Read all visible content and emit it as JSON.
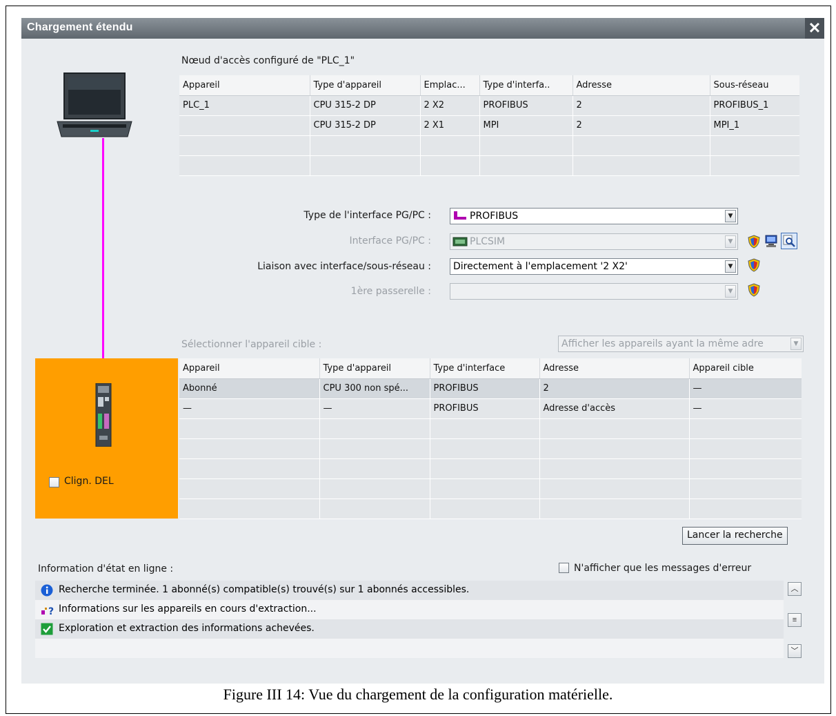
{
  "dialog": {
    "title": "Chargement étendu",
    "close_label": "✕"
  },
  "node": {
    "heading": "Nœud d'accès configuré de \"PLC_1\"",
    "columns": [
      "Appareil",
      "Type d'appareil",
      "Emplac...",
      "Type d'interfa..",
      "Adresse",
      "Sous-réseau"
    ],
    "rows": [
      [
        "PLC_1",
        "CPU 315-2 DP",
        "2 X2",
        "PROFIBUS",
        "2",
        "PROFIBUS_1"
      ],
      [
        "",
        "CPU 315-2 DP",
        "2 X1",
        "MPI",
        "2",
        "MPI_1"
      ],
      [
        "",
        "",
        "",
        "",
        "",
        ""
      ],
      [
        "",
        "",
        "",
        "",
        "",
        ""
      ]
    ]
  },
  "settings": {
    "type_label": "Type de l'interface PG/PC :",
    "type_value": "PROFIBUS",
    "interface_label": "Interface PG/PC :",
    "interface_value": "PLCSIM",
    "liaison_label": "Liaison avec interface/sous-réseau :",
    "liaison_value": "Directement à l'emplacement '2 X2'",
    "gateway_label": "1ère passerelle :",
    "gateway_value": ""
  },
  "target": {
    "select_label": "Sélectionner l'appareil cible :",
    "filter_value": "Afficher les appareils ayant la même adre",
    "columns": [
      "Appareil",
      "Type d'appareil",
      "Type d'interface",
      "Adresse",
      "Appareil cible"
    ],
    "rows": [
      [
        "Abonné",
        "CPU 300 non spé...",
        "PROFIBUS",
        "2",
        "—"
      ],
      [
        "—",
        "—",
        "PROFIBUS",
        "Adresse d'accès",
        "—"
      ],
      [
        "",
        "",
        "",
        "",
        ""
      ],
      [
        "",
        "",
        "",
        "",
        ""
      ],
      [
        "",
        "",
        "",
        "",
        ""
      ],
      [
        "",
        "",
        "",
        "",
        ""
      ],
      [
        "",
        "",
        "",
        "",
        ""
      ]
    ]
  },
  "flash_led_label": "Clign. DEL",
  "search_button": "Lancer la recherche",
  "status": {
    "heading": "Information d'état en ligne :",
    "errors_only_label": "N'afficher que les messages d'erreur",
    "messages": [
      {
        "icon": "info-icon",
        "text": "Recherche terminée. 1 abonné(s) compatible(s) trouvé(s) sur 1 abonnés accessibles."
      },
      {
        "icon": "device-query-icon",
        "text": "Informations sur les appareils en cours d'extraction..."
      },
      {
        "icon": "check-icon",
        "text": "Exploration et extraction des informations achevées."
      }
    ]
  },
  "caption": "Figure III 14: Vue du chargement de la configuration matérielle.",
  "colors": {
    "accent_orange": "#ff9e00",
    "link_line": "#ff00ff",
    "info_blue": "#1a5fd6",
    "ok_green": "#1e9e3a"
  }
}
